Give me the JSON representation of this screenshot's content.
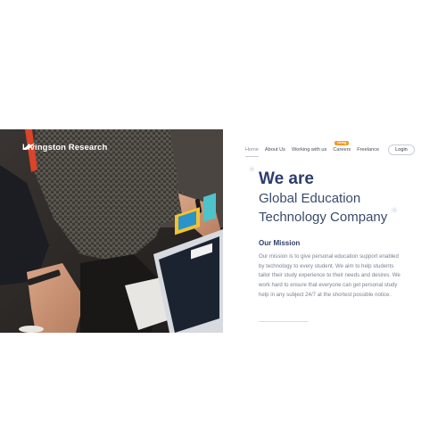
{
  "brand": {
    "name": "Livingston Research"
  },
  "nav": {
    "items": [
      {
        "label": "Home",
        "active": true
      },
      {
        "label": "About Us"
      },
      {
        "label": "Working with us"
      },
      {
        "label": "Careers",
        "badge": "hiring"
      },
      {
        "label": "Freelance"
      }
    ],
    "login_label": "Login"
  },
  "hero": {
    "line1": "We are",
    "line2": "Global Education",
    "line3": "Technology Company"
  },
  "mission": {
    "title": "Our Mission",
    "body": "Our mission is to give personal education support enabled by technology to every student. We aim to help students tailor their study experience to their needs and desires. We work hard to ensure that everyone can get personal study help in any subject 24/7 at the shortest possible notice."
  },
  "colors": {
    "accent": "#2c3e6a",
    "badge": "#f39a24",
    "body_text": "#7c8191"
  },
  "icons": {
    "logo": "bird-icon"
  }
}
